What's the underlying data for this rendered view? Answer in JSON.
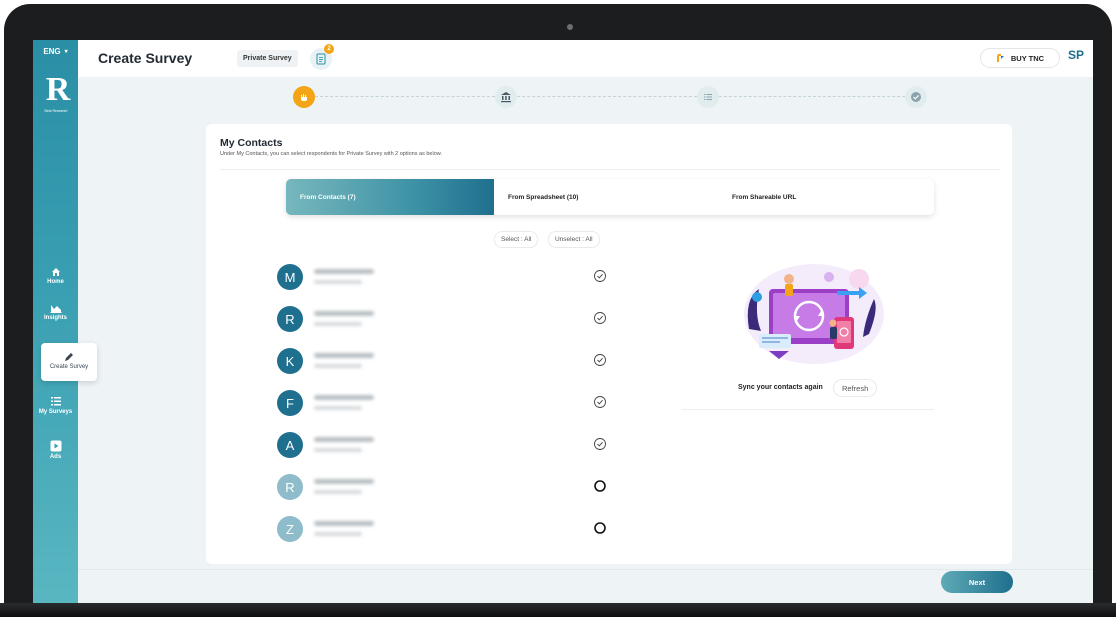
{
  "sidebar": {
    "language": "ENG",
    "brand_mark": "R",
    "brand_name": "Best Research",
    "items": [
      {
        "label": "Home",
        "icon": "home-icon"
      },
      {
        "label": "Insights",
        "icon": "insights-icon"
      },
      {
        "label": "Create Survey",
        "icon": "pencil-icon",
        "active": true
      },
      {
        "label": "My Surveys",
        "icon": "list-icon"
      },
      {
        "label": "Ads",
        "icon": "play-icon"
      }
    ]
  },
  "header": {
    "title": "Create Survey",
    "survey_type": "Private Survey",
    "doc_badge": "2",
    "buy_label": "BUY TNC",
    "avatar": "SP"
  },
  "stepper": {
    "steps": [
      {
        "icon": "hand-icon",
        "state": "active"
      },
      {
        "icon": "bank-icon",
        "state": "pending"
      },
      {
        "icon": "list-icon",
        "state": "pending"
      },
      {
        "icon": "check-icon",
        "state": "pending"
      }
    ]
  },
  "main": {
    "title": "My Contacts",
    "subtitle": "Under My Contacts, you can select respondents for Private Survey with 2 options as below.",
    "tabs": [
      {
        "label": "From Contacts (7)",
        "active": true
      },
      {
        "label": "From Spreadsheet (10)",
        "active": false
      },
      {
        "label": "From Shareable URL",
        "active": false
      }
    ],
    "select_all": "Select : All",
    "unselect_all": "Unselect : All",
    "contacts": [
      {
        "initial": "M",
        "selected": true
      },
      {
        "initial": "R",
        "selected": true
      },
      {
        "initial": "K",
        "selected": true
      },
      {
        "initial": "F",
        "selected": true
      },
      {
        "initial": "A",
        "selected": true
      },
      {
        "initial": "R",
        "selected": false
      },
      {
        "initial": "Z",
        "selected": false
      }
    ],
    "sync_text": "Sync your contacts again",
    "refresh_label": "Refresh"
  },
  "footer": {
    "next_label": "Next"
  },
  "colors": {
    "accent": "#1f6f8e",
    "sidebar": "#3a9fb2",
    "step_active": "#f3a417"
  }
}
